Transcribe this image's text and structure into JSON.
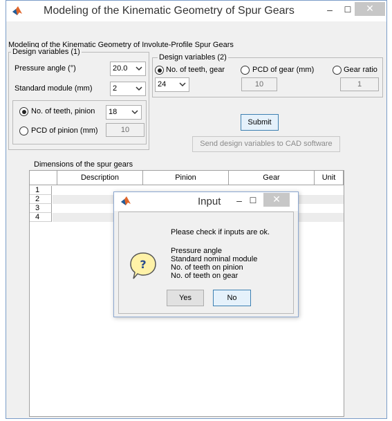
{
  "window": {
    "title": "Modeling of the Kinematic Geometry of Spur Gears",
    "subtitle": "Modeling of the Kinematic Geometry of Involute-Profile Spur Gears",
    "minimize_glyph": "–",
    "maximize_glyph": "☐",
    "close_glyph": "✕"
  },
  "group1": {
    "legend": "Design variables (1)",
    "pressure_angle_label": "Pressure angle (°)",
    "pressure_angle_value": "20.0",
    "module_label": "Standard module (mm)",
    "module_value": "2",
    "teeth_pinion_label": "No. of teeth, pinion",
    "teeth_pinion_value": "18",
    "pcd_pinion_label": "PCD of pinion (mm)",
    "pcd_pinion_value": "10"
  },
  "group2": {
    "legend": "Design variables (2)",
    "teeth_gear_label": "No. of teeth, gear",
    "teeth_gear_value": "24",
    "pcd_gear_label": "PCD of gear (mm)",
    "pcd_gear_value": "10",
    "gear_ratio_label": "Gear ratio",
    "gear_ratio_value": "1"
  },
  "actions": {
    "submit_label": "Submit",
    "send_cad_label": "Send design variables to CAD software"
  },
  "table": {
    "caption": "Dimensions of the spur gears",
    "columns": [
      "Description",
      "Pinion",
      "Gear",
      "Unit"
    ],
    "row_numbers": [
      "1",
      "2",
      "3",
      "4"
    ]
  },
  "dialog": {
    "title": "Input",
    "message": "Please check if inputs are ok.",
    "items": [
      "Pressure angle",
      "Standard nominal module",
      "No. of teeth on pinion",
      "No. of teeth on gear"
    ],
    "yes_label": "Yes",
    "no_label": "No",
    "icon_glyph": "?"
  },
  "colors": {
    "window_bg": "#f0f0f0",
    "titlebar_bg": "#ffffff",
    "close_button_bg": "#c7c7c7",
    "dialog_icon_fill": "#fff2a8",
    "focus_border": "#3c7fb1"
  }
}
